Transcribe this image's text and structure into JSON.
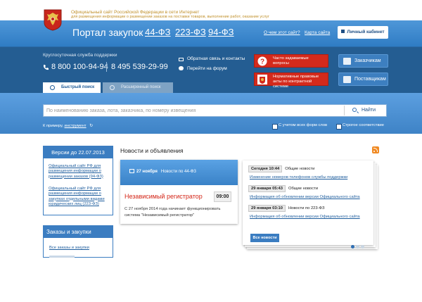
{
  "header": {
    "line1": "Официальный сайт Российской Федерации в сети Интернет",
    "line2": "для размещения информации о размещении заказов на поставки товаров, выполнение работ, оказание услуг"
  },
  "mainbar": {
    "portal": "Портал закупок",
    "laws": [
      "44-ФЗ",
      "223-ФЗ",
      "94-ФЗ"
    ],
    "about": "О чем этот сайт?",
    "sitemap": "Карта сайта",
    "cabinet": "Личный кабинет"
  },
  "support": {
    "label": "Круглосуточная служба поддержки",
    "phone1": "8 800 100-94-94",
    "phone2": "8 495 539-29-99",
    "feedback": "Обратная связь и контакты",
    "forum": "Перейти на форум"
  },
  "red_buttons": [
    "Часто задаваемые вопросы",
    "Нормативные правовые акты по контрактной системе"
  ],
  "blue_buttons": [
    "Заказчикам",
    "Поставщикам"
  ],
  "tabs": {
    "quick": "Быстрый поиск",
    "advanced": "Расширенный поиск"
  },
  "search": {
    "placeholder": "По наименованию заказа, лота, заказчика, по номеру извещения",
    "button": "Найти",
    "example_label": "К примеру,",
    "example_link": "инструмент",
    "opt1": "С учетом всех форм слов",
    "opt2": "Строгое соответствие"
  },
  "version_box": {
    "title": "Версии до 22.07.2013",
    "link1": "Официальный сайт РФ для размещения информации о размещении заказов (94-ФЗ)",
    "link2": "Официальный сайт РФ для размещения информации о закупках отдельными видами юридических лиц (223-ФЗ)"
  },
  "zakupki_box": {
    "title": "Заказы и закупки",
    "link1": "Все заказы и закупки"
  },
  "news": {
    "title": "Новости и объявления",
    "card": {
      "date": "27 ноября",
      "category": "Новости по 44-ФЗ",
      "headline": "Независимый регистратор",
      "time": "09:00",
      "text": "С 27 ноября 2014 года начинает функционировать система \"Независимый регистратор\""
    },
    "list": [
      {
        "date": "Сегодня 10:44",
        "category": "Общие новости",
        "link": "Изменение номеров телефонов службы поддержки"
      },
      {
        "date": "29 января 05:43",
        "category": "Общие новости",
        "link": "Информация об обновлении версии Официального сайта"
      },
      {
        "date": "29 января 03:10",
        "category": "Новости по 223-ФЗ",
        "link": "Информация об обновлении версии Официального сайта"
      }
    ],
    "all_button": "Все новости"
  },
  "colors": {
    "brand_blue": "#3b7dc1",
    "dark_band": "#245d92",
    "red_button": "#d42a1c",
    "headline_red": "#d32416"
  }
}
